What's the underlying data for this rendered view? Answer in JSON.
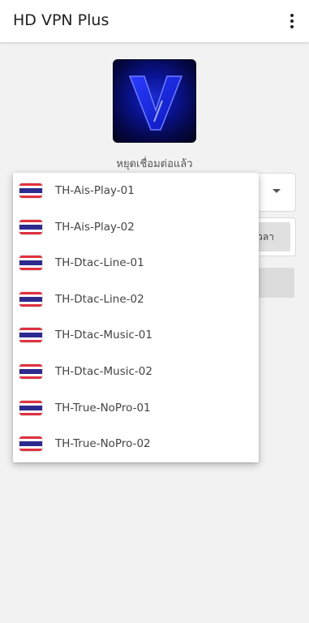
{
  "appbar": {
    "title": "HD VPN Plus",
    "menu_icon": "overflow-menu-icon"
  },
  "logo": {
    "letter": "V",
    "colors": {
      "bg": "#0a1394",
      "letter": "#1b2cff"
    }
  },
  "status": {
    "text": "หยุดเชื่อมต่อแล้ว"
  },
  "time_button": {
    "label": "เวลา"
  },
  "dropdown": {
    "flag_icon": "thailand-flag-icon",
    "items": [
      {
        "label": "TH-Ais-Play-01"
      },
      {
        "label": "TH-Ais-Play-02"
      },
      {
        "label": "TH-Dtac-Line-01"
      },
      {
        "label": "TH-Dtac-Line-02"
      },
      {
        "label": "TH-Dtac-Music-01"
      },
      {
        "label": "TH-Dtac-Music-02"
      },
      {
        "label": "TH-True-NoPro-01"
      },
      {
        "label": "TH-True-NoPro-02"
      }
    ]
  }
}
